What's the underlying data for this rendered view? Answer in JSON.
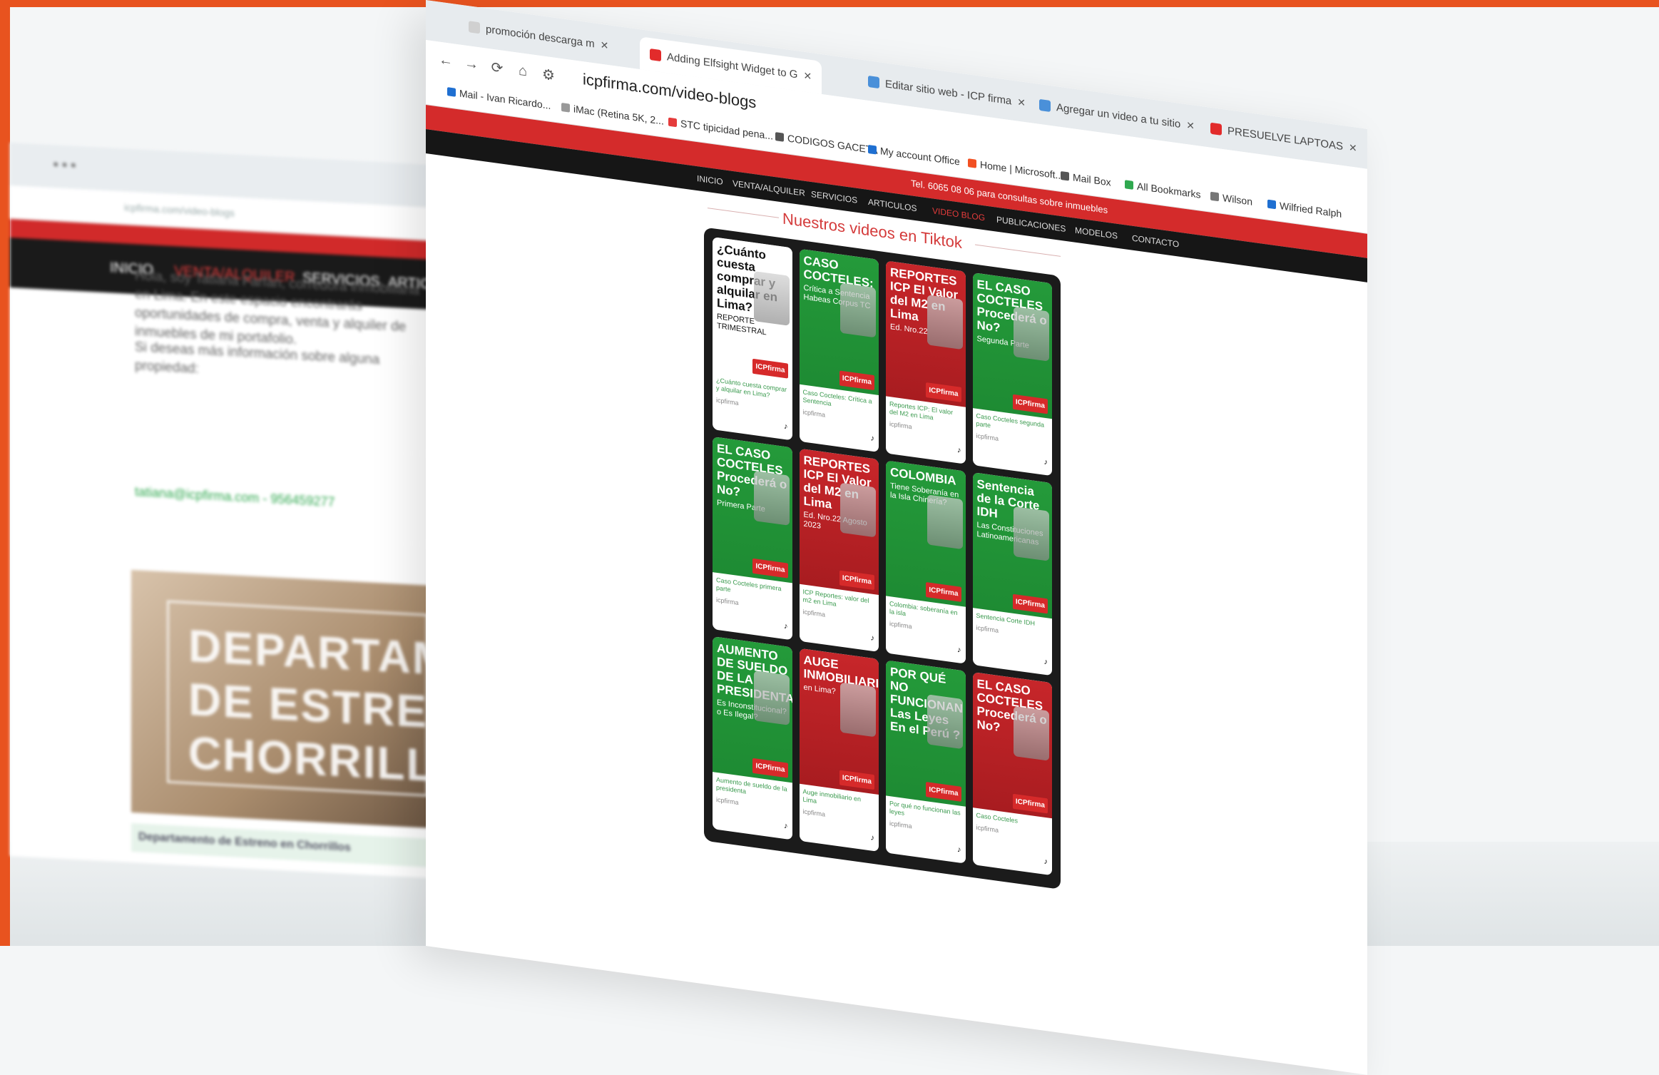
{
  "background_window": {
    "nav": {
      "item1": "INICIO",
      "item2": "VENTA/ALQUILER",
      "item3": "SERVICIOS",
      "item4": "ARTICU"
    },
    "phone_banner": "Tel. 6065 08 06",
    "text1": "Hola, soy Tatiana Farfán, corredora inmobiliaria en Lima. En este espacio encontrarás oportunidades de compra, venta y alquiler de inmuebles de mi portafolio.",
    "text2": "Si deseas más información sobre alguna propiedad:",
    "link": "tatiana@icpfirma.com - 956459277",
    "photo_text": [
      "DEPARTAM",
      "DE ESTREN",
      "CHORRILL"
    ],
    "photo_caption": "Departamento de Estreno en Chorrillos"
  },
  "browser": {
    "tabs": [
      {
        "label": "promoción descarga m",
        "favicon_color": "#d0d0d0"
      },
      {
        "label": "Adding Elfsight Widget to G",
        "favicon_color": "#e22b2b"
      },
      {
        "label": "Editar sitio web - ICP firma",
        "favicon_color": "#4a90d9"
      },
      {
        "label": "Agregar un video a tu sitio",
        "favicon_color": "#4a90d9"
      },
      {
        "label": "PRESUELVE LAPTOAS",
        "favicon_color": "#e22b2b"
      }
    ],
    "url": "icpfirma.com/video-blogs",
    "bookmarks": [
      {
        "label": "Mail - Ivan Ricardo...",
        "color": "#1f6fd1"
      },
      {
        "label": "iMac (Retina 5K, 2...",
        "color": "#999999"
      },
      {
        "label": "STC tipicidad pena...",
        "color": "#e53b3b"
      },
      {
        "label": "CODIGOS GACETA",
        "color": "#555555"
      },
      {
        "label": "My account Office",
        "color": "#1f6fd1"
      },
      {
        "label": "Home | Microsoft...",
        "color": "#f25022"
      },
      {
        "label": "Mail Box",
        "color": "#555555"
      },
      {
        "label": "All Bookmarks",
        "color": "#2fa84f"
      },
      {
        "label": "Wilson",
        "color": "#777777"
      },
      {
        "label": "Wilfried Ralph",
        "color": "#1f6fd1"
      }
    ]
  },
  "site": {
    "red_banner": "Tel. 6065 08 06 para consultas sobre inmuebles",
    "nav": [
      "INICIO",
      "VENTA/ALQUILER",
      "SERVICIOS",
      "ARTICULOS",
      "VIDEO BLOG",
      "PUBLICACIONES",
      "MODELOS",
      "CONTACTO"
    ],
    "section_title": "Nuestros videos en Tiktok"
  },
  "tiktok_cards": [
    {
      "style": "white",
      "title": "¿Cuánto cuesta comprar y alquilar en Lima?",
      "sub": "REPORTE TRIMESTRAL",
      "caption": "¿Cuánto cuesta comprar y alquilar en Lima?",
      "account": "icpfirma"
    },
    {
      "style": "green",
      "title": "CASO COCTELES:",
      "sub": "Crítica a Sentencia Habeas Corpus TC",
      "caption": "Caso Cocteles: Crítica a Sentencia",
      "account": "icpfirma"
    },
    {
      "style": "red",
      "title": "REPORTES ICP El Valor del M2 en Lima",
      "sub": "Ed. Nro.22",
      "caption": "Reportes ICP: El valor del M2 en Lima",
      "account": "icpfirma"
    },
    {
      "style": "green",
      "title": "EL CASO COCTELES Procederá o No?",
      "sub": "Segunda Parte",
      "caption": "Caso Cocteles segunda parte",
      "account": "icpfirma"
    },
    {
      "style": "green",
      "title": "EL CASO COCTELES Procederá o No?",
      "sub": "Primera Parte",
      "caption": "Caso Cocteles primera parte",
      "account": "icpfirma"
    },
    {
      "style": "red",
      "title": "REPORTES ICP El Valor del M2 en Lima",
      "sub": "Ed. Nro.22 Agosto 2023",
      "caption": "ICP Reportes: valor del m2 en Lima",
      "account": "icpfirma"
    },
    {
      "style": "green",
      "title": "COLOMBIA",
      "sub": "Tiene Soberanía en la Isla Chinería?",
      "caption": "Colombia: soberanía en la isla",
      "account": "icpfirma"
    },
    {
      "style": "green",
      "title": "Sentencia de la Corte IDH",
      "sub": "Las Constituciones Latinoamericanas",
      "caption": "Sentencia Corte IDH",
      "account": "icpfirma"
    },
    {
      "style": "green",
      "title": "AUMENTO DE SUELDO DE LA PRESIDENTA.",
      "sub": "Es Inconstitucional? o Es Ilegal?",
      "caption": "Aumento de sueldo de la presidenta",
      "account": "icpfirma"
    },
    {
      "style": "red",
      "title": "AUGE INMOBILIARIO",
      "sub": "en Lima?",
      "caption": "Auge inmobiliario en Lima",
      "account": "icpfirma"
    },
    {
      "style": "green",
      "title": "POR QUÉ NO FUNCIONAN Las Leyes En el Perú ?",
      "sub": "",
      "caption": "Por qué no funcionan las leyes",
      "account": "icpfirma"
    },
    {
      "style": "red",
      "title": "EL CASO COCTELES Procederá o No?",
      "sub": "",
      "caption": "Caso Cocteles",
      "account": "icpfirma"
    }
  ],
  "brand_tag": "ICPfirma",
  "tiktok_icon": "tiktok-icon"
}
